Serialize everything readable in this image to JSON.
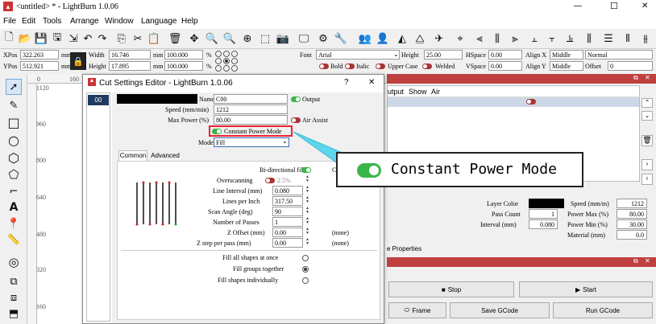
{
  "window": {
    "title": "<untitled> * - LightBurn 1.0.06",
    "min": "—",
    "max": "☐",
    "close": "✕"
  },
  "menu": [
    "File",
    "Edit",
    "Tools",
    "Arrange",
    "Window",
    "Language",
    "Help"
  ],
  "pos": {
    "xpos_label": "XPos",
    "xpos": "322.263",
    "ypos_label": "YPos",
    "ypos": "512.921",
    "unit": "mm",
    "width_label": "Width",
    "width": "16.746",
    "height_label": "Height",
    "height": "17.895",
    "w_pct": "100.000",
    "h_pct": "100.000",
    "pct": "%"
  },
  "font": {
    "label": "Font",
    "value": "Arial",
    "height_label": "Height",
    "height": "25.00",
    "hspace_label": "HSpace",
    "hspace": "0.00",
    "alignx_label": "Align X",
    "alignx": "Middle",
    "normal": "Normal",
    "bold": "Bold",
    "italic": "Italic",
    "upper": "Upper Case",
    "welded": "Welded",
    "vspace_label": "VSpace",
    "vspace": "0.00",
    "aligny_label": "Align Y",
    "aligny": "Middle",
    "offset_label": "Offset",
    "offset": "0"
  },
  "ruler": {
    "top": [
      "0",
      "160"
    ],
    "left": [
      "1120",
      "960",
      "800",
      "640",
      "480",
      "320",
      "160"
    ]
  },
  "dialog": {
    "title": "Cut Settings Editor - LightBurn 1.0.06",
    "help": "?",
    "close": "✕",
    "layer": "00",
    "name_label": "Name",
    "name": "C00",
    "output_label": "Output",
    "speed_label": "Speed (mm/min)",
    "speed": "1212",
    "maxpower_label": "Max Power (%)",
    "maxpower": "80.00",
    "airassist_label": "Air Assist",
    "cpm_label": "Constant Power Mode",
    "mode_label": "Mode",
    "mode": "Fill",
    "tabs": [
      "Common",
      "Advanced"
    ],
    "bidir_label": "Bi-directional fill",
    "c_trunc": "C",
    "overscan_label": "Overscanning",
    "overscan": "2.5%",
    "interval_label": "Line Interval (mm)",
    "interval": "0.080",
    "lpi_label": "Lines per Inch",
    "lpi": "317.50",
    "angle_label": "Scan Angle (deg)",
    "angle": "90",
    "passes_label": "Number of Passes",
    "passes": "1",
    "zoffset_label": "Z Offset (mm)",
    "zoffset": "0.00",
    "none1": "(none)",
    "zstep_label": "Z step per pass (mm)",
    "zstep": "0.00",
    "none2": "(none)",
    "fill_options": [
      "Fill all shapes at once",
      "Fill groups together",
      "Fill shapes individually"
    ],
    "fill_selected": 1
  },
  "callout": {
    "label": "Constant Power Mode"
  },
  "cuts": {
    "columns": [
      "utput",
      "Show",
      "Air"
    ],
    "color": "#000000"
  },
  "layer_panel": {
    "color_label": "Layer Color",
    "speed_label": "Speed (mm/m)",
    "speed": "1212",
    "passcount_label": "Pass Count",
    "passcount": "1",
    "powermax_label": "Power Max (%)",
    "powermax": "80.00",
    "interval_label": "Interval (mm)",
    "interval": "0.080",
    "powermin_label": "Power Min (%)",
    "powermin": "30.00",
    "material_label": "Material (mm)",
    "material": "0.0",
    "props_tab": "e Properties"
  },
  "laser": {
    "stop": "Stop",
    "start": "Start",
    "frame": "Frame",
    "save": "Save GCode",
    "run": "Run GCode"
  }
}
